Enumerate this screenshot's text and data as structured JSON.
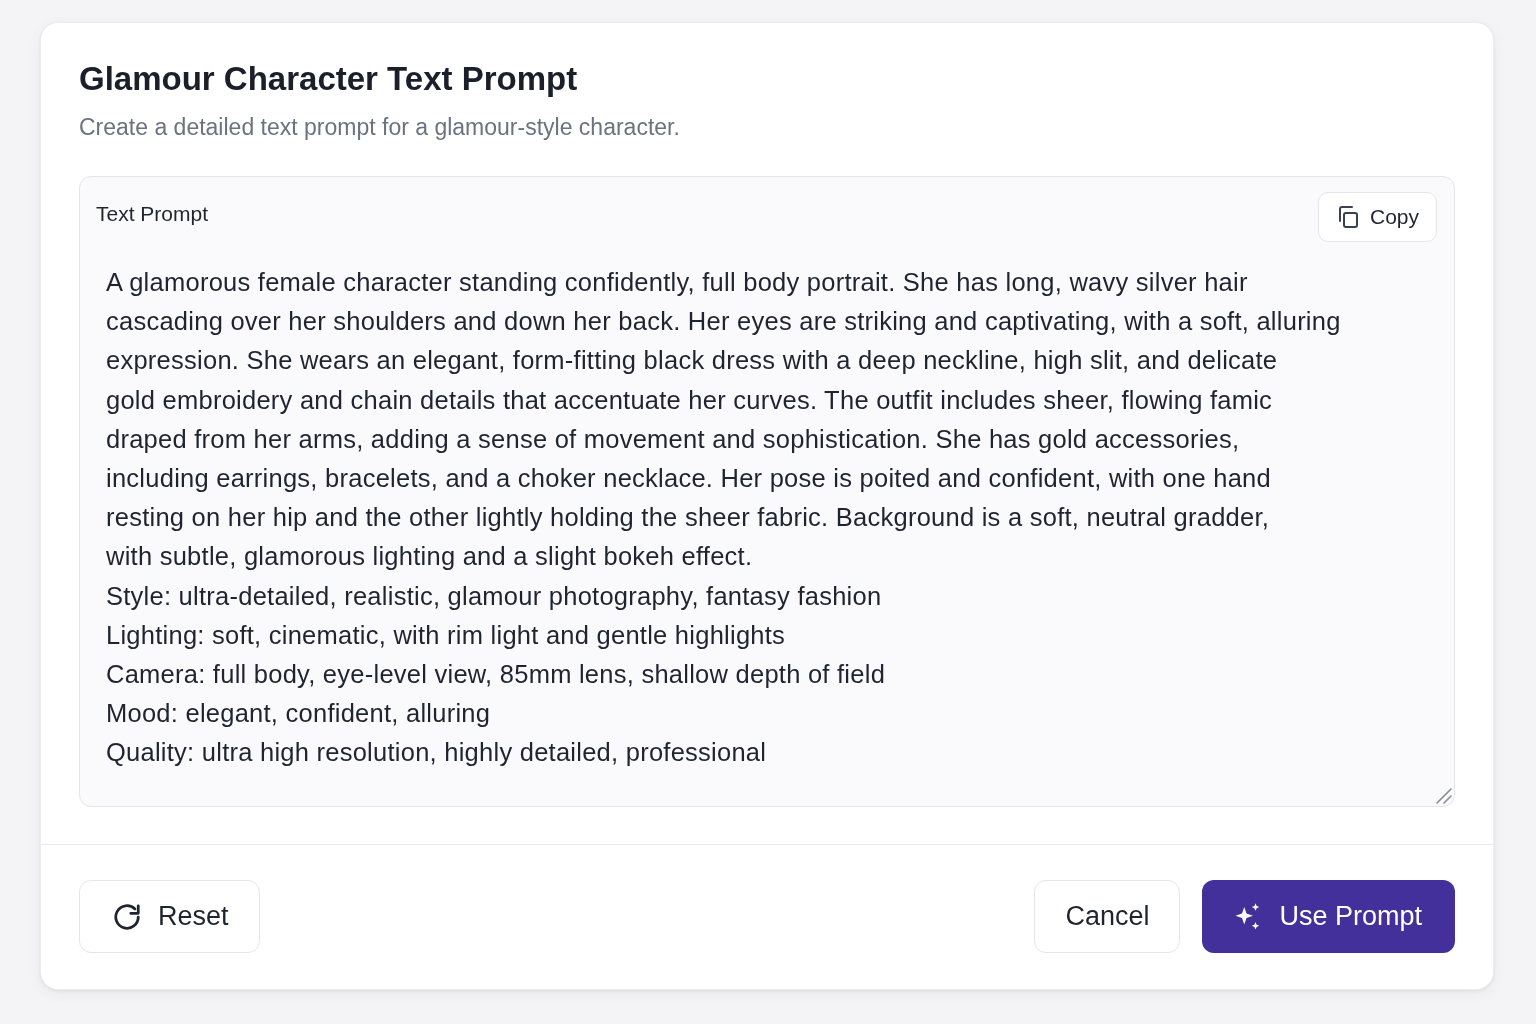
{
  "dialog": {
    "title": "Glamour Character Text Prompt",
    "subtitle": "Create a detailed text prompt for a glamour-style character."
  },
  "prompt_panel": {
    "label": "Text Prompt",
    "copy_button": "Copy",
    "value": "A glamorous female character standing confidently, full body portrait. She has long, wavy silver hair\ncascading over her shoulders and down her back. Her eyes are striking and captivating, with a soft, alluring\nexpression. She wears an elegant, form-fitting black dress with a deep neckline, high slit, and delicate\ngold embroidery and chain details that accentuate her curves. The outfit includes sheer, flowing famic\ndraped from her arms, adding a sense of movement and sophistication. She has gold accessories,\nincluding earrings, bracelets, and a choker necklace. Her pose is poited and confident, with one hand\nresting on her hip and the other lightly holding the sheer fabric. Background is a soft, neutral gradder,\nwith subtle, glamorous lighting and a slight bokeh effect.\nStyle: ultra-detailed, realistic, glamour photography, fantasy fashion\nLighting: soft, cinematic, with rim light and gentle highlights\nCamera: full body, eye-level view, 85mm lens, shallow depth of field\nMood: elegant, confident, alluring\nQuality: ultra high resolution, highly detailed, professional"
  },
  "footer": {
    "buttons": [
      {
        "label": "Reset",
        "kind": "reset"
      },
      {
        "label": "Cancel",
        "kind": "secondary"
      },
      {
        "label": "Use Prompt",
        "kind": "primary"
      }
    ]
  }
}
